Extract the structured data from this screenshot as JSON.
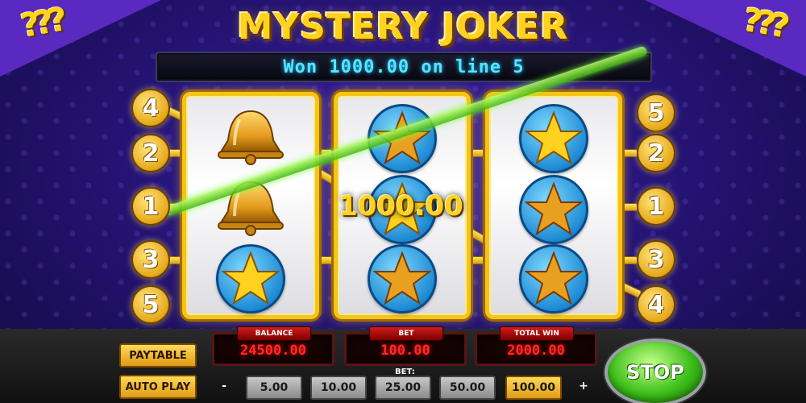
{
  "game": {
    "title": "MYSTERY JOKER",
    "corner_glyphs": "???"
  },
  "win_message": "Won 1000.00 on line 5",
  "win_amount_overlay": "1000.00",
  "paylines": {
    "left": [
      "4",
      "2",
      "1",
      "3",
      "5"
    ],
    "right": [
      "5",
      "2",
      "1",
      "3",
      "4"
    ],
    "winning_line": "5"
  },
  "reels": [
    {
      "symbols": [
        "bell",
        "bell",
        "star"
      ]
    },
    {
      "symbols": [
        "star",
        "star",
        "star"
      ]
    },
    {
      "symbols": [
        "star",
        "star",
        "star"
      ]
    }
  ],
  "panel": {
    "paytable_label": "PAYTABLE",
    "autoplay_label": "AUTO PLAY",
    "balance_label": "BALANCE",
    "balance_value": "24500.00",
    "bet_label": "BET",
    "bet_value": "100.00",
    "total_win_label": "TOTAL WIN",
    "total_win_value": "2000.00",
    "bet_selector_label": "BET:",
    "bet_options": [
      "5.00",
      "10.00",
      "25.00",
      "50.00",
      "100.00"
    ],
    "selected_bet": "100.00",
    "decrease_label": "-",
    "increase_label": "+",
    "stop_label": "STOP"
  },
  "colors": {
    "accent_gold": "#ffd21f",
    "win_text_cyan": "#4fe8ff",
    "display_red": "#ff2a2a",
    "winline_green": "#43b80f",
    "background_purple": "#23126e"
  }
}
